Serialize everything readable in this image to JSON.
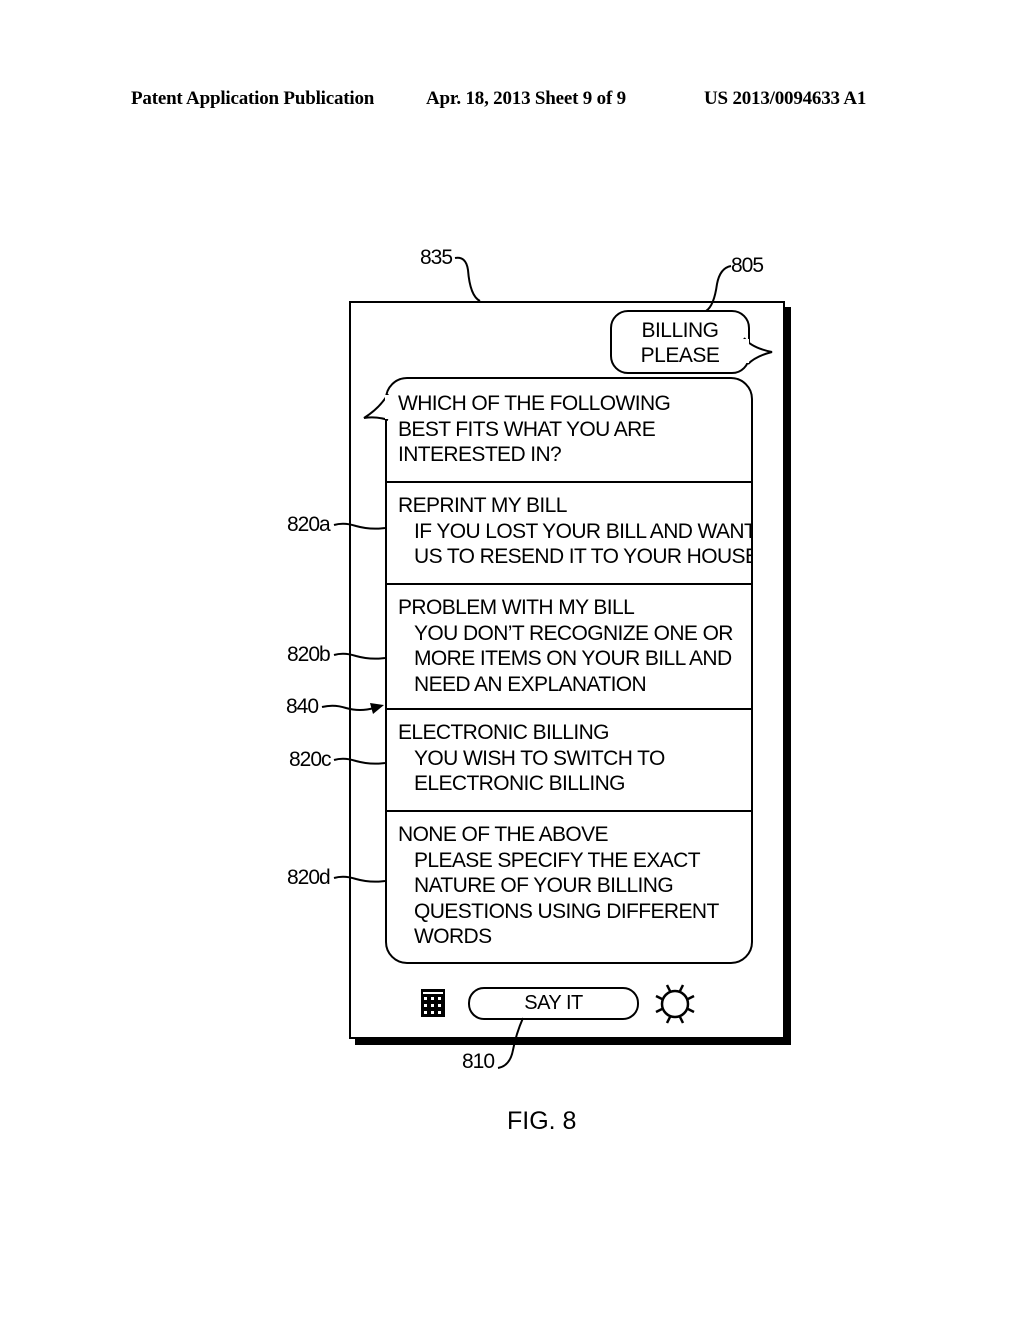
{
  "header": {
    "publication": "Patent Application Publication",
    "date_sheet": "Apr. 18, 2013  Sheet 9 of 9",
    "patent_number": "US 2013/0094633 A1"
  },
  "figure_label": "FIG. 8",
  "reference_numerals": {
    "device": "835",
    "user_bubble": "805",
    "say_it_button": "810",
    "option_a": "820a",
    "option_b": "820b",
    "option_c": "820c",
    "option_d": "820d",
    "divider": "840"
  },
  "user_message": {
    "line1": "BILLING",
    "line2": "PLEASE"
  },
  "system_prompt": {
    "lines": [
      "WHICH OF THE FOLLOWING",
      "BEST FITS WHAT YOU ARE",
      "INTERESTED IN?"
    ]
  },
  "options": [
    {
      "title": "REPRINT MY BILL",
      "description": [
        "IF YOU LOST YOUR BILL AND WANT",
        "US TO RESEND IT TO YOUR HOUSE"
      ]
    },
    {
      "title": "PROBLEM WITH MY BILL",
      "description": [
        "YOU DON’T RECOGNIZE ONE OR",
        "MORE ITEMS ON YOUR BILL AND",
        "NEED AN EXPLANATION"
      ]
    },
    {
      "title": "ELECTRONIC BILLING",
      "description": [
        "YOU WISH TO SWITCH TO",
        "ELECTRONIC BILLING"
      ]
    },
    {
      "title": "NONE OF THE ABOVE",
      "description": [
        "PLEASE SPECIFY THE EXACT",
        "NATURE OF YOUR BILLING",
        "QUESTIONS USING DIFFERENT",
        "WORDS"
      ]
    }
  ],
  "toolbar": {
    "keypad_icon": "keypad-icon",
    "say_it_label": "SAY IT",
    "settings_icon": "sun-settings-icon"
  }
}
